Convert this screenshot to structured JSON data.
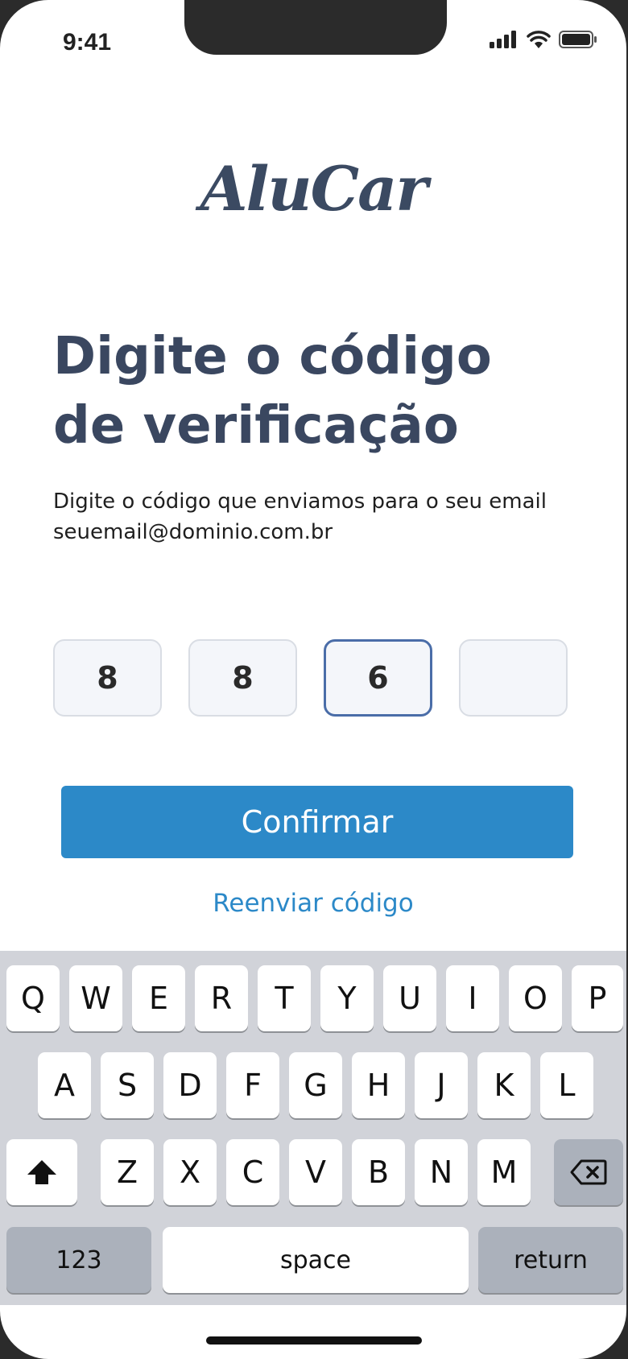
{
  "status_bar": {
    "time": "9:41",
    "icons": [
      "signal-icon",
      "wifi-icon",
      "battery-icon"
    ]
  },
  "brand": {
    "logo": "AluCar"
  },
  "screen": {
    "title_line1": "Digite o código",
    "title_line2": "de verificação",
    "subtitle_line1": "Digite o código que enviamos para o seu email",
    "subtitle_line2": "seuemail@dominio.com.br"
  },
  "code": {
    "digits": [
      "8",
      "8",
      "6",
      ""
    ],
    "active_index": 2
  },
  "actions": {
    "confirm_label": "Confirmar",
    "resend_label": "Reenviar código"
  },
  "keyboard": {
    "row1": [
      "Q",
      "W",
      "E",
      "R",
      "T",
      "Y",
      "U",
      "I",
      "O",
      "P"
    ],
    "row2": [
      "A",
      "S",
      "D",
      "F",
      "G",
      "H",
      "J",
      "K",
      "L"
    ],
    "row3": [
      "Z",
      "X",
      "C",
      "V",
      "B",
      "N",
      "M"
    ],
    "numbers_label": "123",
    "space_label": "space",
    "return_label": "return",
    "shift_icon": "shift-icon",
    "delete_icon": "backspace-icon"
  },
  "colors": {
    "primary": "#2c89c8",
    "title": "#3a4760",
    "active_border": "#4a6da8"
  }
}
